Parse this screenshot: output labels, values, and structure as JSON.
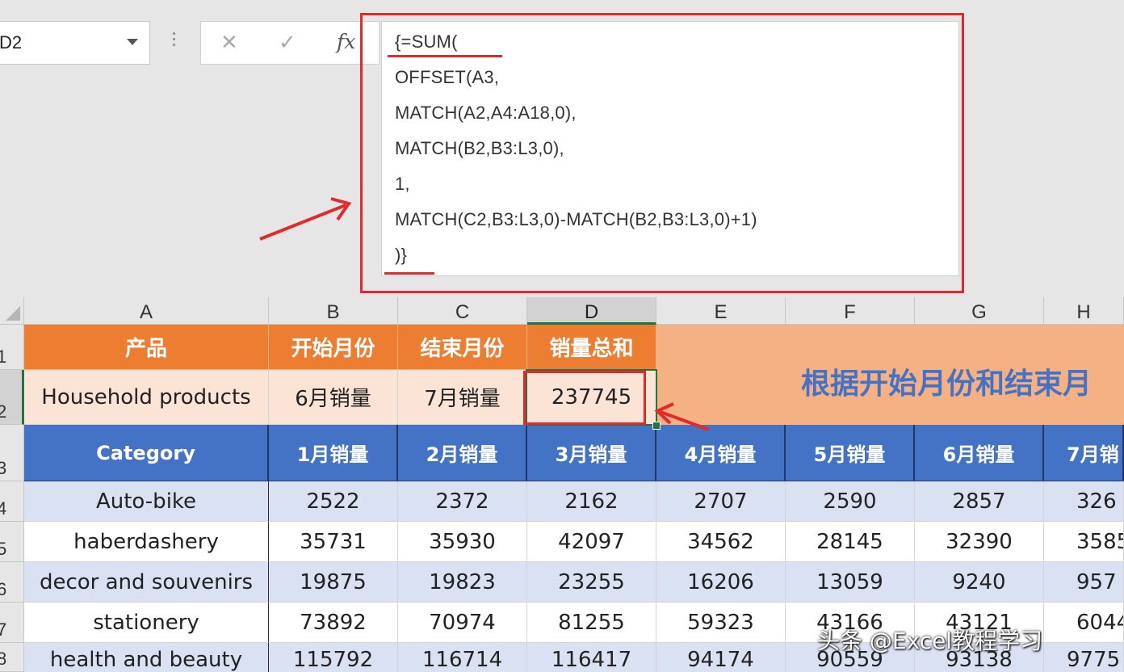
{
  "name_box": {
    "value": "D2"
  },
  "formula_bar": {
    "cancel_glyph": "✕",
    "enter_glyph": "✓",
    "fx_label": "fx",
    "lines": [
      "{=SUM(",
      "OFFSET(A3,",
      "MATCH(A2,A4:A18,0),",
      "MATCH(B2,B3:L3,0),",
      "1,",
      "MATCH(C2,B3:L3,0)-MATCH(B2,B3:L3,0)+1)",
      ")}"
    ]
  },
  "columns": [
    "A",
    "B",
    "C",
    "D",
    "E",
    "F",
    "G",
    "H"
  ],
  "selected_column": "D",
  "rows": [
    "1",
    "2",
    "3",
    "4",
    "5",
    "6",
    "7",
    "8"
  ],
  "selected_row": "2",
  "header_row": {
    "a": "产品",
    "b": "开始月份",
    "c": "结束月份",
    "d": "销量总和"
  },
  "input_row": {
    "a": "Household products",
    "b": "6月销量",
    "c": "7月销量",
    "d": "237745"
  },
  "banner_text": "根据开始月份和结束月",
  "table_header": [
    "Category",
    "1月销量",
    "2月销量",
    "3月销量",
    "4月销量",
    "5月销量",
    "6月销量",
    "7月销"
  ],
  "table_rows": [
    [
      "Auto-bike",
      "2522",
      "2372",
      "2162",
      "2707",
      "2590",
      "2857",
      "326"
    ],
    [
      "haberdashery",
      "35731",
      "35930",
      "42097",
      "34562",
      "28145",
      "32390",
      "3585"
    ],
    [
      "decor and souvenirs",
      "19875",
      "19823",
      "23255",
      "16206",
      "13059",
      "9240",
      "957"
    ],
    [
      "stationery",
      "73892",
      "70974",
      "81255",
      "59323",
      "43166",
      "43121",
      "6044"
    ],
    [
      "health and beauty",
      "115792",
      "116714",
      "116417",
      "94174",
      "90559",
      "93138",
      "9775"
    ]
  ],
  "watermark": "头条 @Excel教程学习",
  "colors": {
    "orange_header": "#ed7d31",
    "peach": "#fbe3d6",
    "banner": "#f4b183",
    "blue_header": "#4472c4",
    "band": "#d9e1f2",
    "highlight_red": "#e22a2a",
    "selection_green": "#217346"
  }
}
